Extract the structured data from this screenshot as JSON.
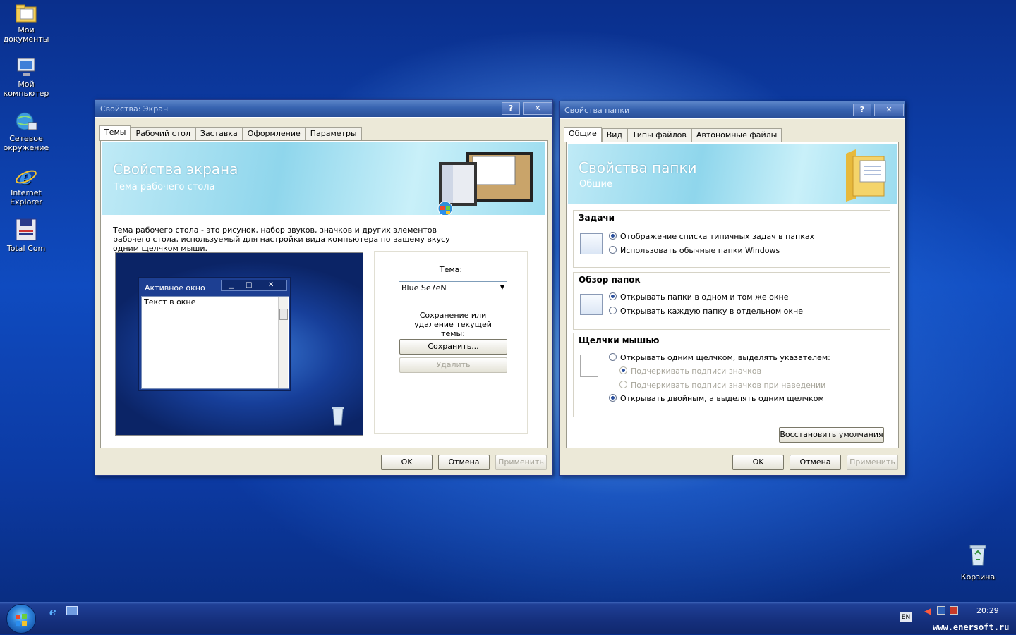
{
  "desktop": {
    "icons": [
      {
        "label": "Мои документы",
        "icon": "my-documents-icon"
      },
      {
        "label": "Мой компьютер",
        "icon": "my-computer-icon"
      },
      {
        "label": "Сетевое окружение",
        "icon": "network-icon"
      },
      {
        "label": "Internet Explorer",
        "icon": "internet-explorer-icon"
      },
      {
        "label": "Total Com",
        "icon": "total-commander-icon"
      }
    ],
    "recycle_bin": "Корзина"
  },
  "display_dialog": {
    "title": "Свойства: Экран",
    "help": "?",
    "close": "✕",
    "tabs": [
      "Темы",
      "Рабочий стол",
      "Заставка",
      "Оформление",
      "Параметры"
    ],
    "banner_title": "Свойства экрана",
    "banner_subtitle": "Тема рабочего стола",
    "description": "Тема рабочего стола - это рисунок, набор звуков, значков и других элементов рабочего стола, используемый для настройки вида компьютера по вашему вкусу одним щелчком мыши.",
    "preview_window_title": "Активное окно",
    "preview_window_text": "Текст в окне",
    "theme_label": "Тема:",
    "theme_value": "Blue Se7eN",
    "save_delete_text": "Сохранение или удаление текущей темы:",
    "save_button": "Сохранить...",
    "delete_button": "Удалить",
    "ok": "OK",
    "cancel": "Отмена",
    "apply": "Применить"
  },
  "folder_dialog": {
    "title": "Свойства папки",
    "help": "?",
    "close": "✕",
    "tabs": [
      "Общие",
      "Вид",
      "Типы файлов",
      "Автономные файлы"
    ],
    "banner_title": "Свойства папки",
    "banner_subtitle": "Общие",
    "tasks": {
      "title": "Задачи",
      "options": [
        {
          "label": "Отображение списка типичных задач в папках",
          "checked": true
        },
        {
          "label": "Использовать обычные папки Windows",
          "checked": false
        }
      ]
    },
    "browse": {
      "title": "Обзор папок",
      "options": [
        {
          "label": "Открывать папки в одном и том же окне",
          "checked": true
        },
        {
          "label": "Открывать каждую папку в отдельном окне",
          "checked": false
        }
      ]
    },
    "clicks": {
      "title": "Щелчки мышью",
      "options": [
        {
          "label": "Открывать одним щелчком, выделять указателем:",
          "checked": false
        },
        {
          "label": "Подчеркивать подписи значков",
          "checked": true,
          "disabled": true
        },
        {
          "label": "Подчеркивать подписи значков при наведении",
          "checked": false,
          "disabled": true
        },
        {
          "label": "Открывать двойным, а выделять одним щелчком",
          "checked": true
        }
      ]
    },
    "restore_button": "Восстановить умолчания",
    "ok": "OK",
    "cancel": "Отмена",
    "apply": "Применить"
  },
  "taskbar": {
    "language": "EN",
    "clock": "20:29",
    "watermark": "www.enersoft.ru"
  }
}
